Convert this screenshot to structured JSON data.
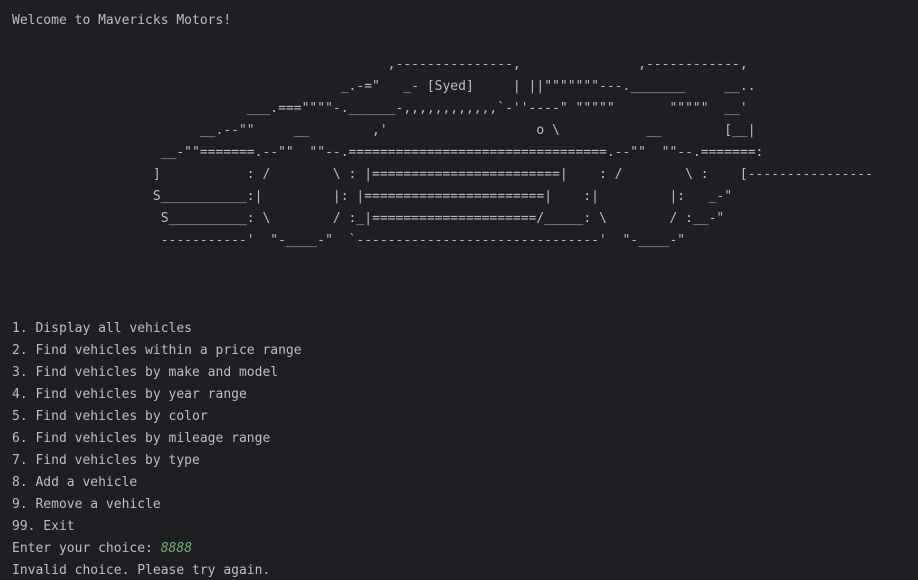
{
  "console": {
    "welcome": "Welcome to Mavericks Motors!",
    "car_art": "                                                ,---------------,               ,------------,\n                                          _.-=\"   _- [Syed]     | ||\"\"\"\"\"\"\"---._______     __..\n                              ___.===\"\"\"\"-.______-,,,,,,,,,,,,`-''----\" \"\"\"\"\"       \"\"\"\"\"  __'\n                        __.--\"\"     __        ,'                   o \\           __        [__|\n                   __-\"\"=======.--\"\"  \"\"--.=================================.--\"\"  \"\"--.=======:\n                  ]           : /        \\ : |========================|    : /        \\ :    [----------------\n                  S___________:|         |: |=======================|    :|         |:   _-\"\n                   S__________: \\        / :_|=====================/_____: \\        / :__-\"\n                   -----------'  \"-____-\"  `-------------------------------'  \"-____-\"",
    "menu": [
      "1. Display all vehicles",
      "2. Find vehicles within a price range",
      "3. Find vehicles by make and model",
      "4. Find vehicles by year range",
      "5. Find vehicles by color",
      "6. Find vehicles by mileage range",
      "7. Find vehicles by type",
      "8. Add a vehicle",
      "9. Remove a vehicle",
      "99. Exit"
    ],
    "prompt": "Enter your choice: ",
    "user_input": "8888",
    "message": "Invalid choice. Please try again."
  },
  "colors": {
    "background": "#1e1f22",
    "text": "#bcbec4",
    "user_input": "#6aab73"
  }
}
